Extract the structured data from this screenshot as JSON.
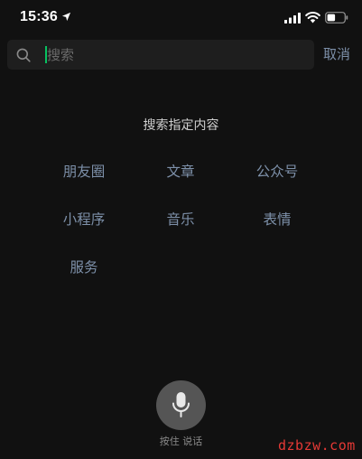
{
  "status_bar": {
    "time": "15:36"
  },
  "search": {
    "placeholder": "搜索",
    "value": "",
    "cancel_label": "取消"
  },
  "content": {
    "title": "搜索指定内容",
    "categories": [
      "朋友圈",
      "文章",
      "公众号",
      "小程序",
      "音乐",
      "表情",
      "服务"
    ]
  },
  "voice": {
    "label": "按住 说话"
  },
  "watermark": "dzbzw.com",
  "colors": {
    "background": "#111111",
    "link": "#7d90a9",
    "accent": "#07c160",
    "watermark": "#e53935"
  },
  "icons": [
    "location-arrow-icon",
    "signal-icon",
    "wifi-icon",
    "battery-icon",
    "search-icon",
    "microphone-icon"
  ]
}
